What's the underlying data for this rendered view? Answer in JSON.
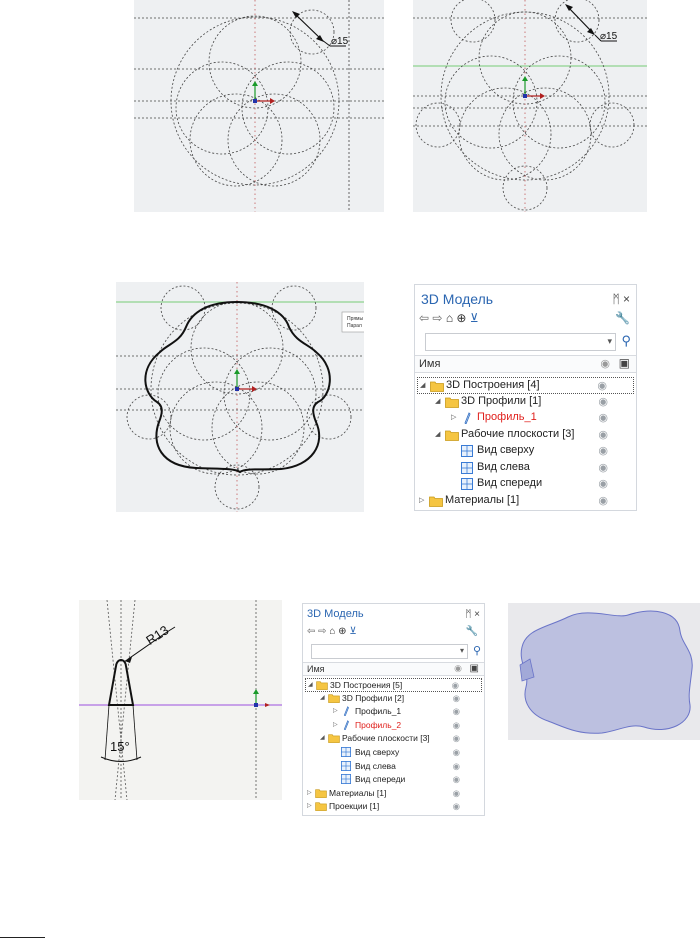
{
  "figures": {
    "sketch_a": {
      "diameter_label": "⌀15"
    },
    "sketch_b": {
      "diameter_label": "⌀15"
    },
    "sketch_c": {
      "tooltip_line1": "Прямы",
      "tooltip_line2": "Парал"
    },
    "sketch_profile": {
      "radius_label": "R13",
      "angle_label": "15°"
    }
  },
  "tree1": {
    "title": "3D Модель",
    "pin": "ᛗ ×",
    "search_placeholder": "",
    "column_name": "Имя",
    "rows": [
      {
        "arrow": "◢",
        "icon": "folder",
        "label": "3D Построения [4]",
        "selected": true
      },
      {
        "arrow": "◢",
        "icon": "folder",
        "label": "3D Профили [1]"
      },
      {
        "arrow": "▷",
        "icon": "profile",
        "label": "Профиль_1",
        "red": true
      },
      {
        "arrow": "◢",
        "icon": "folder",
        "label": "Рабочие плоскости [3]"
      },
      {
        "arrow": "",
        "icon": "plane",
        "label": "Вид сверху"
      },
      {
        "arrow": "",
        "icon": "plane",
        "label": "Вид слева"
      },
      {
        "arrow": "",
        "icon": "plane",
        "label": "Вид спереди"
      },
      {
        "arrow": "▷",
        "icon": "folder",
        "label": "Материалы [1]"
      }
    ]
  },
  "tree2": {
    "title": "3D Модель",
    "pin": "ᛗ ×",
    "search_placeholder": "",
    "column_name": "Имя",
    "rows": [
      {
        "arrow": "◢",
        "icon": "folder",
        "label": "3D Построения [5]",
        "selected": true
      },
      {
        "arrow": "◢",
        "icon": "folder",
        "label": "3D Профили [2]"
      },
      {
        "arrow": "▷",
        "icon": "profile",
        "label": "Профиль_1"
      },
      {
        "arrow": "▷",
        "icon": "profile",
        "label": "Профиль_2",
        "red": true
      },
      {
        "arrow": "◢",
        "icon": "folder",
        "label": "Рабочие плоскости [3]"
      },
      {
        "arrow": "",
        "icon": "plane",
        "label": "Вид сверху"
      },
      {
        "arrow": "",
        "icon": "plane",
        "label": "Вид слева"
      },
      {
        "arrow": "",
        "icon": "plane",
        "label": "Вид спереди"
      },
      {
        "arrow": "▷",
        "icon": "folder",
        "label": "Материалы [1]"
      },
      {
        "arrow": "▷",
        "icon": "folder",
        "label": "Проекции [1]"
      }
    ]
  }
}
